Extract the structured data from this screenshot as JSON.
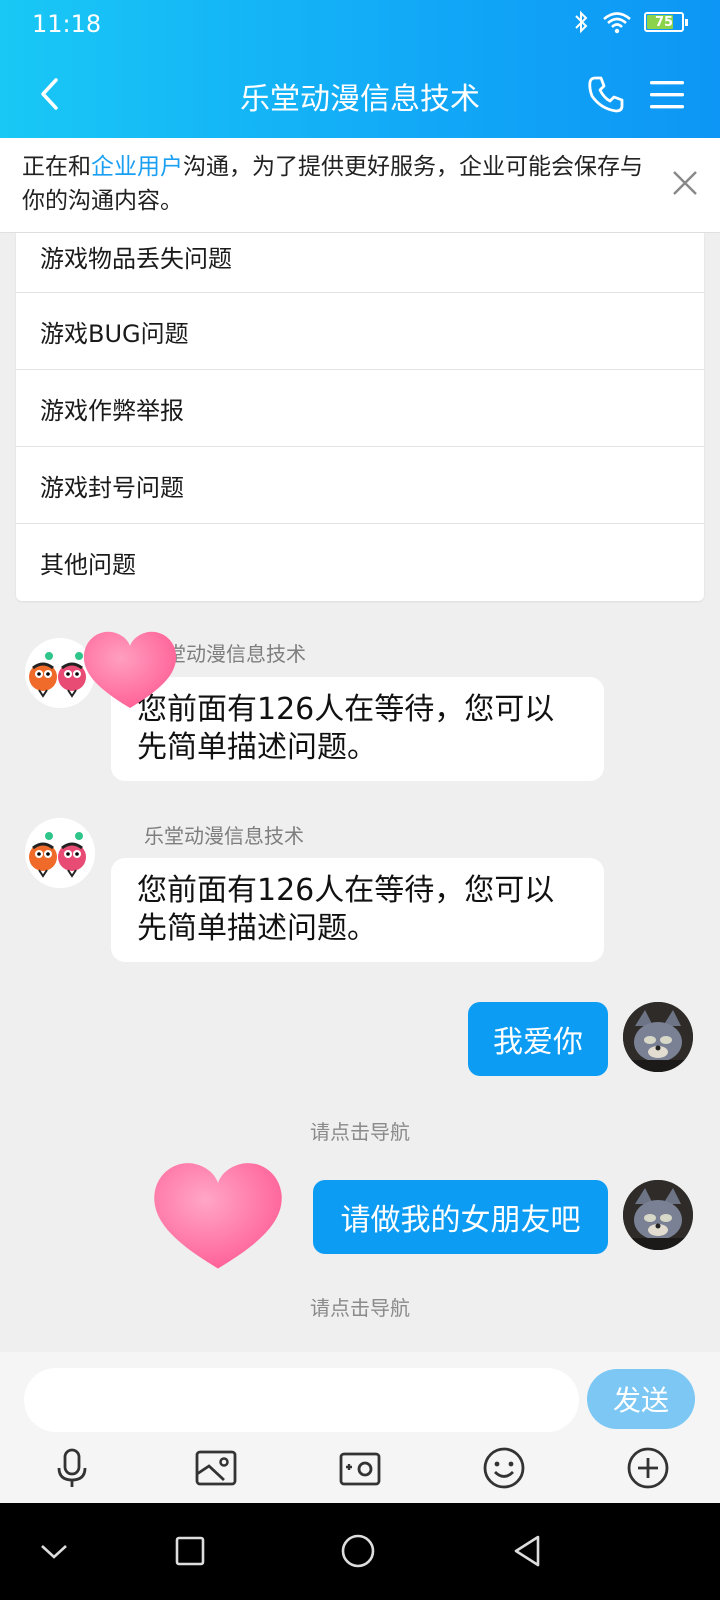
{
  "status_bar": {
    "time": "11:18",
    "battery": "75",
    "battery_fraction": 0.75
  },
  "header": {
    "title": "乐堂动漫信息技术"
  },
  "notice": {
    "text_before": "正在和",
    "link": "企业用户",
    "text_after": "沟通，为了提供更好服务，企业可能会保存与你的沟通内容。"
  },
  "questions": [
    "游戏物品丢失问题",
    "游戏BUG问题",
    "游戏作弊举报",
    "游戏封号问题",
    "其他问题"
  ],
  "messages": {
    "m1_sender_partial": "堂动漫信息技术",
    "m1_text": "您前面有126人在等待，您可以先简单描述问题。",
    "m2_sender": "乐堂动漫信息技术",
    "m2_text": "您前面有126人在等待，您可以先简单描述问题。",
    "m3_text": "我爱你",
    "hint1": "请点击导航",
    "m4_text": "请做我的女朋友吧",
    "hint2": "请点击导航"
  },
  "composer": {
    "input_value": "",
    "send_label": "发送"
  },
  "colors": {
    "header_start": "#19c8f5",
    "header_end": "#0d96f5",
    "bubble_out": "#0d9cf3",
    "send_btn": "#7cc7f4",
    "link": "#1a9ff2",
    "heart": "#ff6fa0"
  }
}
